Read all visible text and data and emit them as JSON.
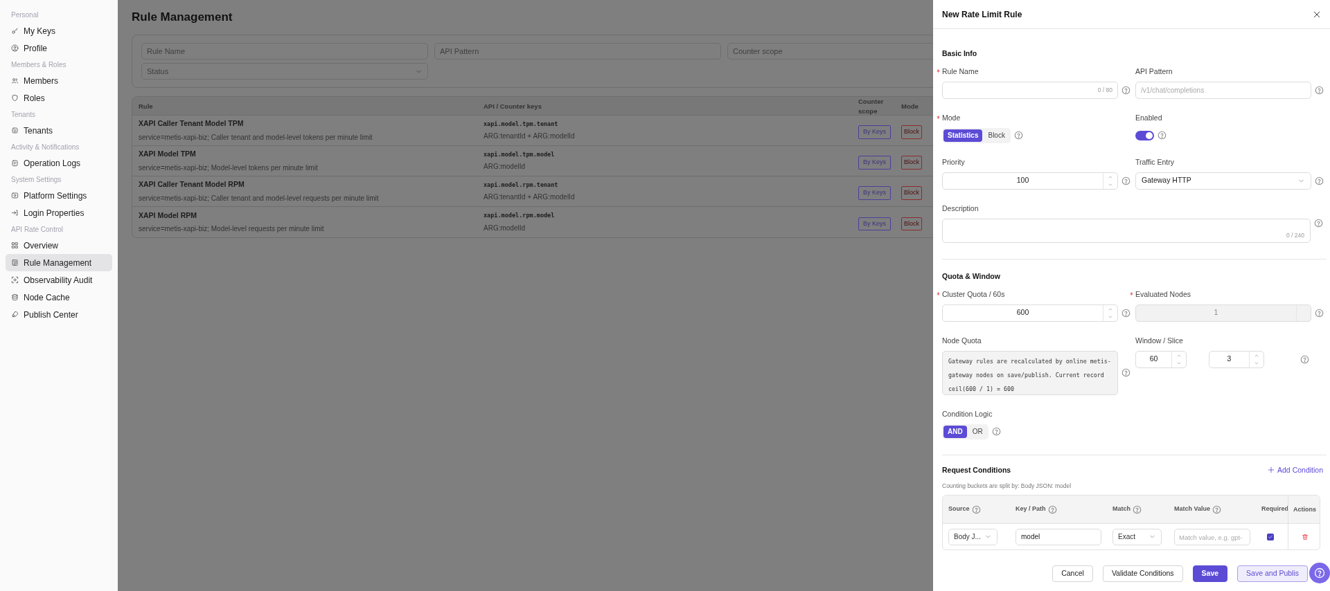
{
  "sidebar": {
    "sections": [
      {
        "heading": "Personal",
        "items": [
          {
            "label": "My Keys",
            "selected": false
          },
          {
            "label": "Profile",
            "selected": false
          }
        ]
      },
      {
        "heading": "Members & Roles",
        "items": [
          {
            "label": "Members",
            "selected": false
          },
          {
            "label": "Roles",
            "selected": false
          }
        ]
      },
      {
        "heading": "Tenants",
        "items": [
          {
            "label": "Tenants",
            "selected": false
          }
        ]
      },
      {
        "heading": "Activity & Notifications",
        "items": [
          {
            "label": "Operation Logs",
            "selected": false
          }
        ]
      },
      {
        "heading": "System Settings",
        "items": [
          {
            "label": "Platform Settings",
            "selected": false
          },
          {
            "label": "Login Properties",
            "selected": false
          }
        ]
      },
      {
        "heading": "API Rate Control",
        "items": [
          {
            "label": "Overview",
            "selected": false
          },
          {
            "label": "Rule Management",
            "selected": true
          },
          {
            "label": "Observability Audit",
            "selected": false
          },
          {
            "label": "Node Cache",
            "selected": false
          },
          {
            "label": "Publish Center",
            "selected": false
          }
        ]
      }
    ]
  },
  "page": {
    "title": "Rule Management",
    "filters": [
      {
        "kind": "input",
        "placeholder": "Rule Name"
      },
      {
        "kind": "input",
        "placeholder": "API Pattern"
      },
      {
        "kind": "input",
        "placeholder": "Counter scope"
      },
      {
        "kind": "select",
        "placeholder": "Status"
      }
    ],
    "table": {
      "columns": [
        "Rule",
        "API / Counter keys",
        "Counter scope",
        "Mode"
      ],
      "rows": [
        {
          "name": "XAPI Caller Tenant Model TPM",
          "description": "service=metis-xapi-biz; Caller tenant and model-level tokens per minute limit",
          "api_key": "xapi.model.tpm.tenant",
          "counter_keys": "ARG:tenantId + ARG:modelId",
          "counter_scope": "By Keys",
          "mode": "Block"
        },
        {
          "name": "XAPI Model TPM",
          "description": "service=metis-xapi-biz; Model-level tokens per minute limit",
          "api_key": "xapi.model.tpm.model",
          "counter_keys": "ARG:modelId",
          "counter_scope": "By Keys",
          "mode": "Block"
        },
        {
          "name": "XAPI Caller Tenant Model RPM",
          "description": "service=metis-xapi-biz; Caller tenant and model-level requests per minute limit",
          "api_key": "xapi.model.rpm.tenant",
          "counter_keys": "ARG:tenantId + ARG:modelId",
          "counter_scope": "By Keys",
          "mode": "Block"
        },
        {
          "name": "XAPI Model RPM",
          "description": "service=metis-xapi-biz; Model-level requests per minute limit",
          "api_key": "xapi.model.rpm.model",
          "counter_keys": "ARG:modelId",
          "counter_scope": "By Keys",
          "mode": "Block"
        }
      ]
    }
  },
  "drawer": {
    "title": "New Rate Limit Rule",
    "basic_info": {
      "heading": "Basic Info",
      "rule_name": {
        "label": "Rule Name",
        "required": true,
        "counter": "0 / 80"
      },
      "api_pattern": {
        "label": "API Pattern",
        "placeholder": "/v1/chat/completions"
      },
      "mode": {
        "label": "Mode",
        "required": true,
        "options": [
          {
            "label": "Statistics",
            "selected": true
          },
          {
            "label": "Block",
            "selected": false
          }
        ]
      },
      "enabled": {
        "label": "Enabled",
        "on": true
      },
      "priority": {
        "label": "Priority",
        "value": "100"
      },
      "traffic_entry": {
        "label": "Traffic Entry",
        "value": "Gateway HTTP"
      },
      "description": {
        "label": "Description",
        "counter": "0 / 240"
      }
    },
    "quota": {
      "heading": "Quota & Window",
      "cluster_quota": {
        "label": "Cluster Quota / 60s",
        "required": true,
        "value": "600"
      },
      "evaluated_nodes": {
        "label": "Evaluated Nodes",
        "required": true,
        "value": "1",
        "disabled": true
      },
      "node_quota": {
        "label": "Node Quota",
        "text": "Gateway rules are recalculated by online metis-gateway nodes on save/publish. Current record ceil(600 / 1) = 600"
      },
      "window_slice": {
        "label": "Window / Slice",
        "window": "60",
        "slice": "3"
      },
      "condition_logic": {
        "label": "Condition Logic",
        "options": [
          {
            "label": "AND",
            "selected": true
          },
          {
            "label": "OR",
            "selected": false
          }
        ]
      }
    },
    "conditions": {
      "heading": "Request Conditions",
      "add_label": "Add Condition",
      "note": "Counting buckets are split by: Body JSON: model",
      "columns": [
        "Source",
        "Key / Path",
        "Match",
        "Match Value",
        "Required",
        "Actions"
      ],
      "rows": [
        {
          "source": "Body J...",
          "key": "model",
          "match": "Exact",
          "value_placeholder": "Match value, e.g. gpt-",
          "required": true
        }
      ]
    },
    "buttons": [
      {
        "label": "Cancel",
        "kind": "default"
      },
      {
        "label": "Validate Conditions",
        "kind": "default"
      },
      {
        "label": "Save",
        "kind": "primary"
      },
      {
        "label": "Save and Publis",
        "kind": "secondary"
      }
    ]
  }
}
